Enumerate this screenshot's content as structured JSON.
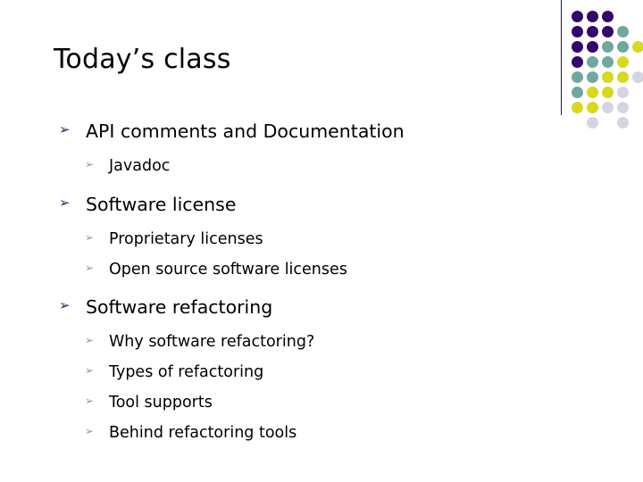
{
  "slide": {
    "title": "Today’s class",
    "bullet_glyph": "➢",
    "colors": {
      "title_text": "#000000",
      "body_text": "#000000",
      "level1_bullet": "#3d2363",
      "level2_bullet": "#7e9d9a",
      "rule": "#1b1b2e",
      "dot_purple": "#33066b",
      "dot_teal": "#6fa8a0",
      "dot_yellow": "#d8d81e",
      "dot_gray": "#d5d5e2",
      "background": "#ffffff"
    },
    "outline": [
      {
        "level": 1,
        "label": "API comments and Documentation",
        "children": [
          {
            "level": 2,
            "label": "Javadoc"
          }
        ]
      },
      {
        "level": 1,
        "label": "Software license",
        "children": [
          {
            "level": 2,
            "label": "Proprietary licenses"
          },
          {
            "level": 2,
            "label": "Open source software licenses"
          }
        ]
      },
      {
        "level": 1,
        "label": "Software refactoring",
        "children": [
          {
            "level": 2,
            "label": "Why software refactoring?"
          },
          {
            "level": 2,
            "label": "Types of refactoring"
          },
          {
            "level": 2,
            "label": "Tool supports"
          },
          {
            "level": 2,
            "label": "Behind refactoring tools"
          }
        ]
      }
    ],
    "decoration": {
      "name": "dot-grid",
      "columns": 5,
      "rows": 9,
      "cell": 17,
      "dot_size": 13,
      "palette_order": [
        "#33066b",
        "#6fa8a0",
        "#d8d81e",
        "#d5d5e2"
      ],
      "matrix": [
        [
          "#33066b",
          "#33066b",
          "#33066b",
          null,
          null
        ],
        [
          "#33066b",
          "#33066b",
          "#33066b",
          "#6fa8a0",
          null
        ],
        [
          "#33066b",
          "#33066b",
          "#6fa8a0",
          "#6fa8a0",
          "#d8d81e"
        ],
        [
          "#33066b",
          "#6fa8a0",
          "#6fa8a0",
          "#d8d81e",
          null
        ],
        [
          "#6fa8a0",
          "#6fa8a0",
          "#d8d81e",
          "#d8d81e",
          "#d5d5e2"
        ],
        [
          "#6fa8a0",
          "#d8d81e",
          "#d8d81e",
          "#d5d5e2",
          null
        ],
        [
          "#d8d81e",
          "#d8d81e",
          "#d5d5e2",
          "#d5d5e2",
          null
        ],
        [
          null,
          "#d5d5e2",
          null,
          "#d5d5e2",
          null
        ],
        [
          null,
          null,
          null,
          null,
          null
        ]
      ]
    }
  }
}
